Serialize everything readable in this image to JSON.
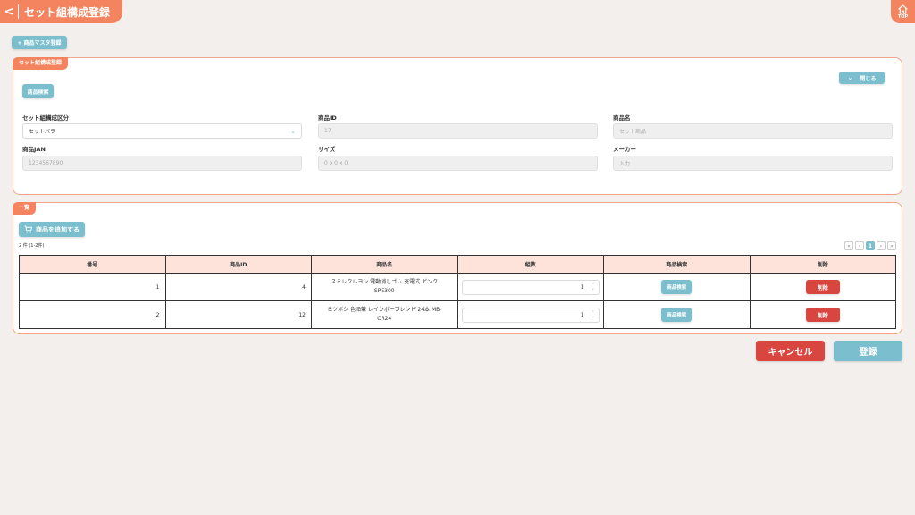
{
  "header": {
    "title": "セット組構成登録",
    "back_label": "<",
    "top_label": "TOP"
  },
  "master_button": "+ 商品マスタ登録",
  "form_panel": {
    "tag": "セット組構成登録",
    "search_button": "商品検索",
    "close_button": "閉じる",
    "fields": {
      "set_type": {
        "label": "セット組構成区分",
        "value": "セットバラ"
      },
      "product_id": {
        "label": "商品ID",
        "value": "17"
      },
      "product_name": {
        "label": "商品名",
        "value": "セット商品"
      },
      "jan": {
        "label": "商品JAN",
        "value": "1234567890"
      },
      "size": {
        "label": "サイズ",
        "value": "0 x 0 x 0"
      },
      "maker": {
        "label": "メーカー",
        "value": "入力"
      }
    }
  },
  "list_panel": {
    "tag": "一覧",
    "add_button": "商品を追加する",
    "count": "2 件 (1-2件)",
    "pager": {
      "first": "«",
      "prev": "‹",
      "current": "1",
      "next": "›",
      "last": "»"
    },
    "columns": [
      "番号",
      "商品ID",
      "商品名",
      "組数",
      "商品検索",
      "削除"
    ],
    "rows": [
      {
        "no": "1",
        "product_id": "4",
        "name": "スミレクレヨン 電動消しゴム 充電式 ピンク SPE300",
        "qty": "1",
        "search": "商品検索",
        "delete": "削除"
      },
      {
        "no": "2",
        "product_id": "12",
        "name": "ミツボシ 色鉛筆 レインボーブレンド 24本 MB-CR24",
        "qty": "1",
        "search": "商品検索",
        "delete": "削除"
      }
    ]
  },
  "footer": {
    "cancel": "キャンセル",
    "submit": "登録"
  },
  "colors": {
    "accent": "#f4845f",
    "teal": "#7bbfce",
    "danger": "#d9453f",
    "header_row": "#fde3da"
  }
}
